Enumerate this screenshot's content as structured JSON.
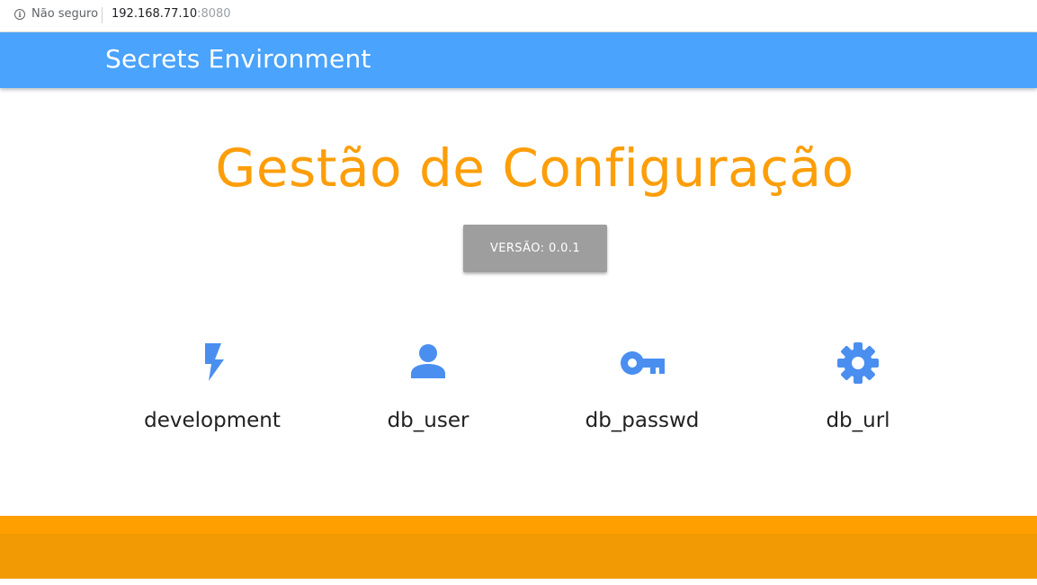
{
  "browser": {
    "security_label": "Não seguro",
    "url_host": "192.168.77.10",
    "url_port": ":8080",
    "info_icon": "info-icon"
  },
  "appbar": {
    "title": "Secrets Environment"
  },
  "main": {
    "title": "Gestão de Configuração",
    "version_button": "VERSÃO: 0.0.1"
  },
  "features": [
    {
      "label": "development",
      "icon": "bolt-icon"
    },
    {
      "label": "db_user",
      "icon": "person-icon"
    },
    {
      "label": "db_passwd",
      "icon": "key-icon"
    },
    {
      "label": "db_url",
      "icon": "gear-icon"
    }
  ],
  "colors": {
    "appbar": "#4aa3fc",
    "title": "#fd9e09",
    "icons": "#4a8ff0",
    "version_button": "#9e9e9e",
    "footer": "#f19a03"
  }
}
